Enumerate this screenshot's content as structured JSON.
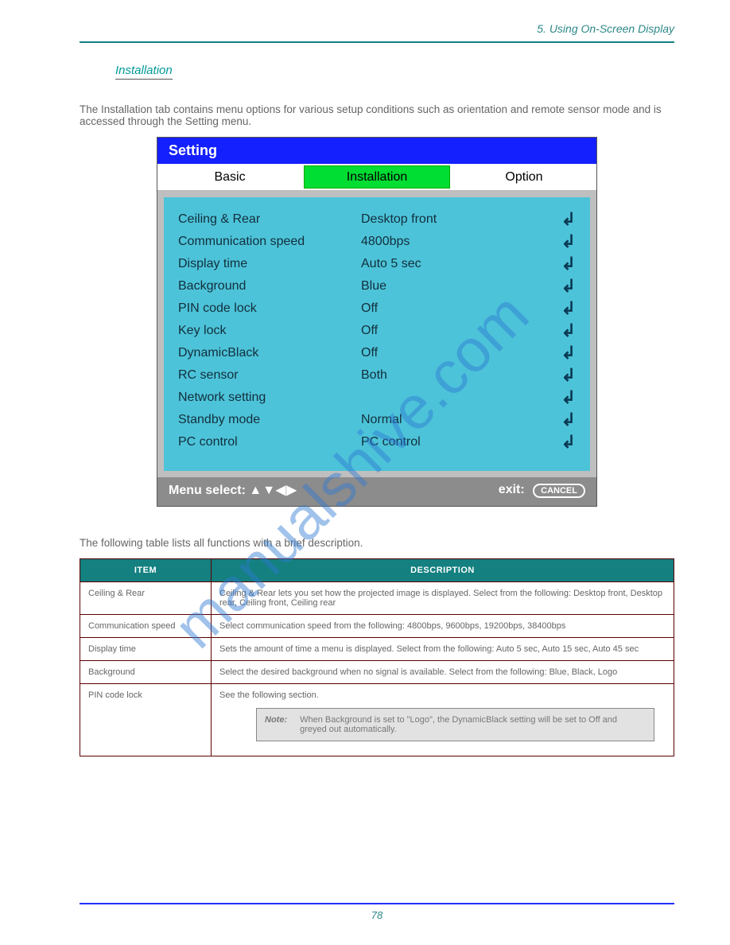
{
  "header_text": "5. Using On-Screen Display",
  "section_title": "Installation",
  "section_tip": "The Installation tab contains menu options for various setup conditions such as orientation and remote sensor mode and is accessed through the Setting menu.",
  "osd": {
    "title": "Setting",
    "tabs": {
      "basic": "Basic",
      "installation": "Installation",
      "option": "Option"
    },
    "rows": [
      {
        "label": "Ceiling & Rear",
        "value": "Desktop front"
      },
      {
        "label": "Communication speed",
        "value": "4800bps"
      },
      {
        "label": "Display time",
        "value": "Auto 5 sec"
      },
      {
        "label": "Background",
        "value": "Blue"
      },
      {
        "label": "PIN code lock",
        "value": "Off"
      },
      {
        "label": "Key lock",
        "value": "Off"
      },
      {
        "label": "DynamicBlack",
        "value": "Off"
      },
      {
        "label": "RC sensor",
        "value": "Both"
      },
      {
        "label": "Network setting",
        "value": ""
      },
      {
        "label": "Standby mode",
        "value": "Normal"
      },
      {
        "label": "PC control",
        "value": "PC control"
      }
    ],
    "footer_left_label": "Menu select:",
    "footer_arrows": "▲▼◀▶",
    "footer_right_label": "exit:",
    "footer_cancel": "CANCEL"
  },
  "desc_table": {
    "head_item": "ITEM",
    "head_desc": "DESCRIPTION",
    "rows": [
      {
        "item": "Ceiling & Rear",
        "desc": "Ceiling & Rear lets you set how the projected image is displayed. Select from the following: Desktop front, Desktop rear, Ceiling front, Ceiling rear"
      },
      {
        "item": "Communication speed",
        "desc": "Select communication speed from the following: 4800bps, 9600bps, 19200bps, 38400bps"
      },
      {
        "item": "Display time",
        "desc": "Sets the amount of time a menu is displayed. Select from the following: Auto 5 sec, Auto 15 sec, Auto 45 sec"
      },
      {
        "item": "Background",
        "desc": "Select the desired background when no signal is available. Select from the following: Blue, Black, Logo"
      },
      {
        "item": "PIN code lock",
        "desc": "See the following section.",
        "note": {
          "label": "Note:",
          "text": "When Background is set to \"Logo\", the DynamicBlack setting will be set to Off and greyed out automatically."
        }
      }
    ]
  },
  "watermark_text": "manualshive.com",
  "page_number": "78"
}
